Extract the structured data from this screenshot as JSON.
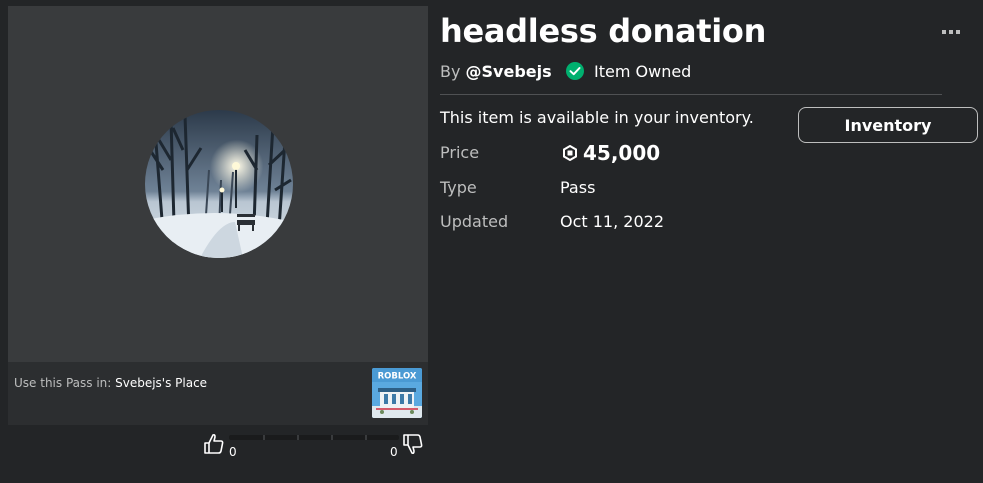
{
  "item": {
    "title": "headless donation",
    "by_prefix": "By ",
    "creator": "@Svebejs",
    "owned_label": "Item Owned",
    "availability": "This item is available in your inventory.",
    "inventory_button": "Inventory"
  },
  "details": {
    "price_label": "Price",
    "price_value": "45,000",
    "type_label": "Type",
    "type_value": "Pass",
    "updated_label": "Updated",
    "updated_value": "Oct 11, 2022"
  },
  "place": {
    "prefix": "Use this Pass in: ",
    "name": "Svebejs's Place",
    "logo_text": "ROBLOX"
  },
  "votes": {
    "up": "0",
    "down": "0"
  },
  "icons": {
    "more": "more-options-icon",
    "owned": "check-circle-icon",
    "robux": "robux-icon",
    "thumb_up": "thumbs-up-icon",
    "thumb_down": "thumbs-down-icon"
  },
  "colors": {
    "background": "#232527",
    "panel": "#393b3d",
    "owned_green": "#00b06f",
    "muted_text": "#bdbebe"
  }
}
